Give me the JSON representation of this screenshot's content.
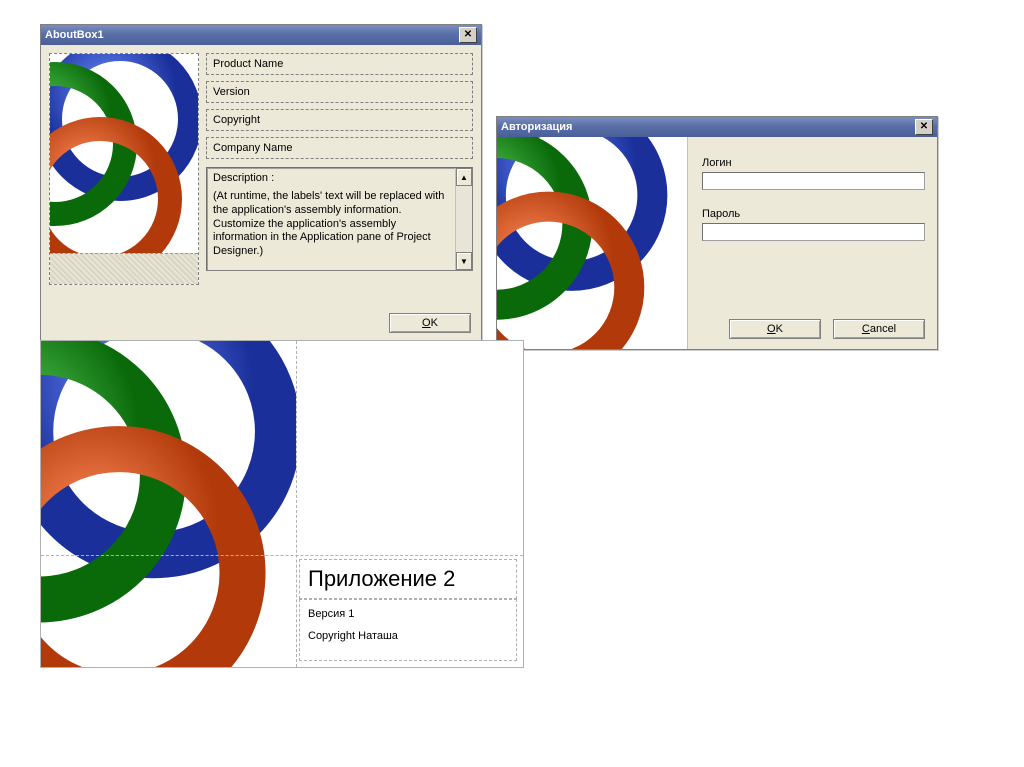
{
  "aboutbox": {
    "title": "AboutBox1",
    "product_name": "Product Name",
    "version": "Version",
    "copyright": "Copyright",
    "company": "Company Name",
    "desc_label": "Description :",
    "desc_text": "(At runtime, the labels' text will be replaced with the application's assembly information. Customize the application's assembly information in the Application pane of Project Designer.)",
    "ok": "OK"
  },
  "auth": {
    "title": "Авторизация",
    "login_label": "Логин",
    "password_label": "Пароль",
    "ok": "OK",
    "cancel": "Cancel"
  },
  "splash": {
    "app_title": "Приложение 2",
    "version": "Версия 1",
    "copyright": "Copyright Наташа"
  }
}
